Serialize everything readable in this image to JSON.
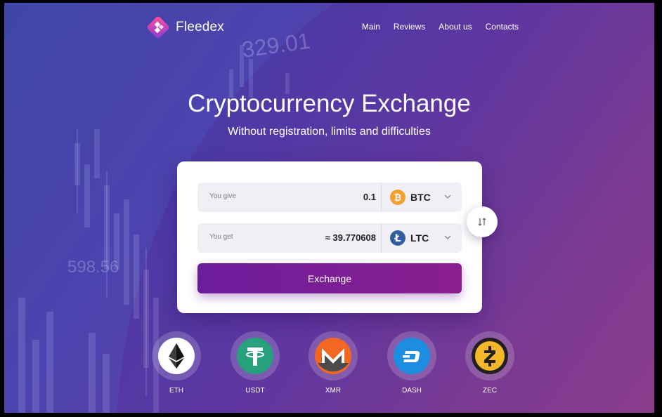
{
  "brand": {
    "name": "Fleedex",
    "logo_icon": "diamond-logo-icon"
  },
  "nav": {
    "items": [
      "Main",
      "Reviews",
      "About us",
      "Contacts"
    ]
  },
  "hero": {
    "title": "Cryptocurrency Exchange",
    "subtitle": "Without registration, limits and difficulties"
  },
  "background": {
    "chart_numbers": [
      "329.01",
      "598.56"
    ]
  },
  "exchange": {
    "give": {
      "label": "You give",
      "value": "0.1",
      "currency": "BTC",
      "icon": "bitcoin-icon"
    },
    "get": {
      "label": "You get",
      "value": "≈ 39.770608",
      "currency": "LTC",
      "icon": "litecoin-icon"
    },
    "button_label": "Exchange",
    "swap_icon": "swap-arrows-icon"
  },
  "coins": [
    {
      "label": "ETH",
      "icon": "ethereum-icon"
    },
    {
      "label": "USDT",
      "icon": "tether-icon"
    },
    {
      "label": "XMR",
      "icon": "monero-icon"
    },
    {
      "label": "DASH",
      "icon": "dash-icon"
    },
    {
      "label": "ZEC",
      "icon": "zcash-icon"
    }
  ],
  "colors": {
    "accent": "#7a1e96",
    "btc": "#f2a12f",
    "ltc": "#345d9d",
    "usdt": "#26a17b",
    "xmr": "#f26822",
    "dash": "#1c8de0",
    "zec": "#f4b728"
  }
}
